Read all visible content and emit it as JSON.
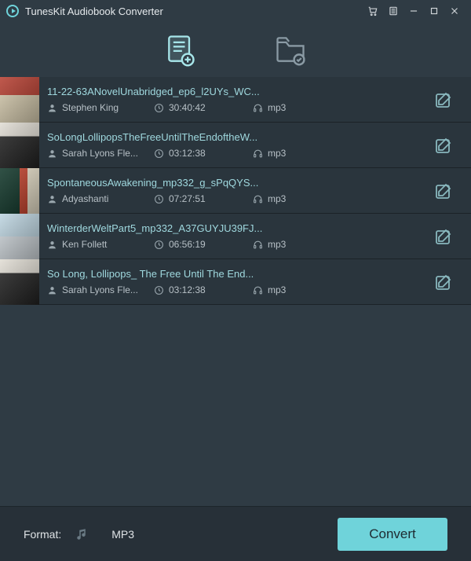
{
  "app": {
    "title": "TunesKit Audiobook Converter"
  },
  "items": [
    {
      "title": "11-22-63ANovelUnabridged_ep6_l2UYs_WC...",
      "author": "Stephen King",
      "duration": "30:40:42",
      "format": "mp3"
    },
    {
      "title": "SoLongLollipopsTheFreeUntilTheEndoftheW...",
      "author": "Sarah Lyons Fle...",
      "duration": "03:12:38",
      "format": "mp3"
    },
    {
      "title": "SpontaneousAwakening_mp332_g_sPqQYS...",
      "author": "Adyashanti",
      "duration": "07:27:51",
      "format": "mp3"
    },
    {
      "title": "WinterderWeltPart5_mp332_A37GUYJU39FJ...",
      "author": "Ken Follett",
      "duration": "06:56:19",
      "format": "mp3"
    },
    {
      "title": "So Long, Lollipops_ The Free Until The End...",
      "author": "Sarah Lyons Fle...",
      "duration": "03:12:38",
      "format": "mp3"
    }
  ],
  "footer": {
    "format_label": "Format:",
    "format_value": "MP3",
    "convert_label": "Convert"
  }
}
